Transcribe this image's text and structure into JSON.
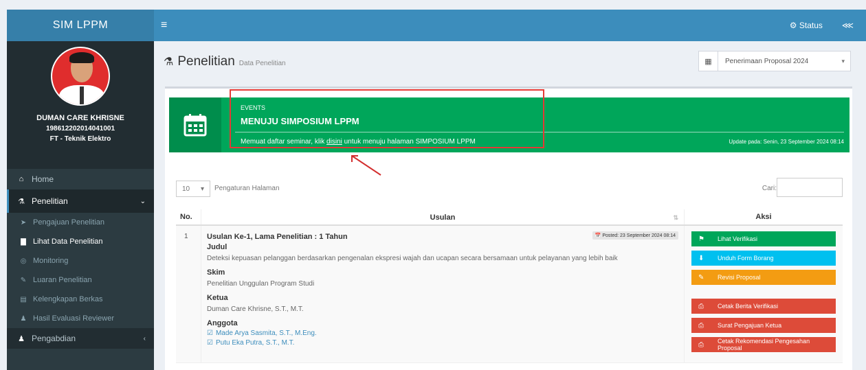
{
  "app": {
    "logo": "SIM LPPM"
  },
  "user": {
    "name": "DUMAN CARE KHRISNE",
    "nip": "198612202014041001",
    "unit": "FT - Teknik Elektro"
  },
  "sidebar": {
    "home": "Home",
    "penelitian": "Penelitian",
    "submenu": [
      "Pengajuan Penelitian",
      "Lihat Data Penelitian",
      "Monitoring",
      "Luaran Penelitian",
      "Kelengkapan Berkas",
      "Hasil Evaluasi Reviewer"
    ],
    "pengabdian": "Pengabdian"
  },
  "topbar": {
    "menu_icon": "menu-icon",
    "settings": "Status"
  },
  "page": {
    "title": "Penelitian",
    "subtitle": "Data Penelitian",
    "year_select": "Penerimaan Proposal 2024"
  },
  "event": {
    "label": "EVENTS",
    "title": "MENUJU SIMPOSIUM LPPM",
    "desc_before": "Memuat daftar seminar, klik ",
    "desc_link": "disini",
    "desc_after": " untuk menuju halaman SIMPOSIUM LPPM",
    "date": "Update pada: Senin, 23 September 2024 08:14"
  },
  "table_tools": {
    "length_value": "10",
    "length_text": "Pengaturan Halaman",
    "search_label": "Cari:"
  },
  "table": {
    "headers": {
      "no": "No.",
      "usulan": "Usulan",
      "aksi": "Aksi"
    },
    "rows": [
      {
        "no": "1",
        "heading": "Usulan Ke-1, Lama Penelitian : 1 Tahun",
        "posted": "Posted: 23 September 2024 08:14",
        "judul_label": "Judul",
        "judul": "Deteksi kepuasan pelanggan berdasarkan pengenalan ekspresi wajah dan ucapan secara bersamaan untuk pelayanan yang lebih baik",
        "skim_label": "Skim",
        "skim": "Penelitian Unggulan Program Studi",
        "ketua_label": "Ketua",
        "ketua": "Duman Care Khrisne, S.T., M.T.",
        "anggota_label": "Anggota",
        "anggota": [
          "Made Arya Sasmita, S.T., M.Eng.",
          "Putu Eka Putra, S.T., M.T."
        ]
      }
    ]
  },
  "actions": {
    "green": "Lihat Verifikasi",
    "cyan": "Unduh Form Borang",
    "orange": "Revisi Proposal",
    "red1": "Cetak Berita Verifikasi",
    "red2": "Surat Pengajuan Ketua",
    "red3": "Cetak Rekomendasi Pengesahan Proposal"
  }
}
